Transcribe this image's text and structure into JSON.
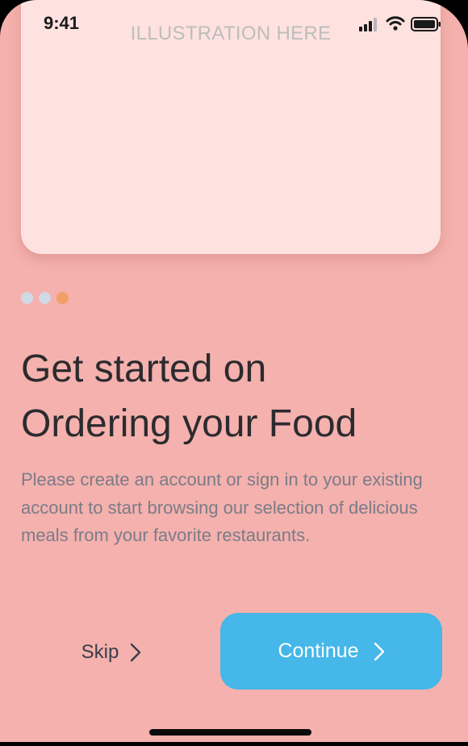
{
  "status_bar": {
    "time": "9:41",
    "icons": [
      "signal-icon",
      "wifi-icon",
      "battery-icon"
    ]
  },
  "illustration": {
    "placeholder": "ILLUSTRATION HERE"
  },
  "pager": {
    "total": 3,
    "active_index": 2,
    "colors": {
      "inactive": "#d2d9e6",
      "active": "#f0a064"
    }
  },
  "headline": {
    "line1": "Get started on",
    "line2": "Ordering your Food"
  },
  "description": "Please create an account or sign in to your existing account to start browsing our selection of delicious meals from your favorite restaurants.",
  "actions": {
    "skip_label": "Skip",
    "skip_icon": "chevron-right-icon",
    "continue_label": "Continue",
    "continue_icon": "chevron-right-icon"
  },
  "colors": {
    "background": "#f4b1ad",
    "card": "#fde2e0",
    "accent": "#45b7e8",
    "headline": "#2c2b2f",
    "body_text": "#7b7c88"
  }
}
